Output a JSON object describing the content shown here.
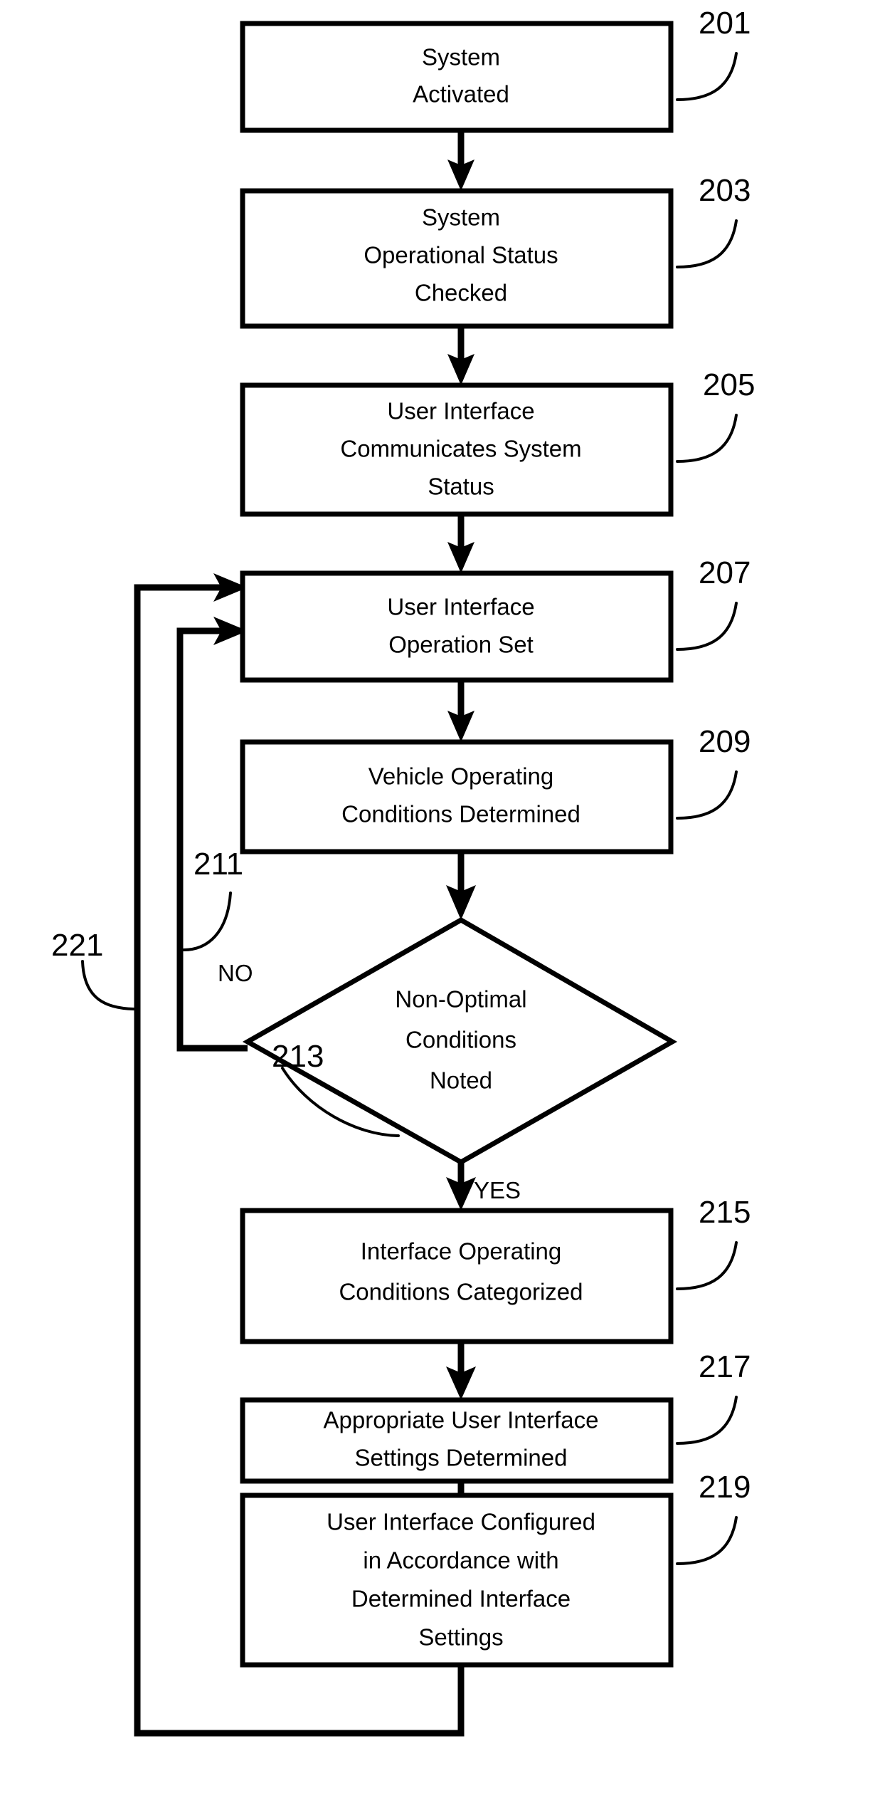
{
  "figure": {
    "type": "patent-flowchart",
    "nodes": [
      {
        "ref": "201",
        "shape": "process",
        "lines": [
          "System",
          "Activated"
        ],
        "line1": "System",
        "line2": "Activated",
        "line3": "",
        "line4": ""
      },
      {
        "ref": "203",
        "shape": "process",
        "lines": [
          "System",
          "Operational Status",
          "Checked"
        ],
        "line1": "System",
        "line2": "Operational Status",
        "line3": "Checked",
        "line4": ""
      },
      {
        "ref": "205",
        "shape": "process",
        "lines": [
          "User Interface",
          "Communicates System",
          "Status"
        ],
        "line1": "User Interface",
        "line2": "Communicates System",
        "line3": "Status",
        "line4": ""
      },
      {
        "ref": "207",
        "shape": "process",
        "lines": [
          "User Interface",
          "Operation Set"
        ],
        "line1": "User Interface",
        "line2": "Operation Set",
        "line3": "",
        "line4": ""
      },
      {
        "ref": "209",
        "shape": "process",
        "lines": [
          "Vehicle Operating",
          "Conditions Determined"
        ],
        "line1": "Vehicle Operating",
        "line2": "Conditions Determined",
        "line3": "",
        "line4": ""
      },
      {
        "ref": "211",
        "shape": "decision",
        "lines": [
          "Non-Optimal",
          "Conditions",
          "Noted"
        ],
        "line1": "Non-Optimal",
        "line2": "Conditions",
        "line3": "Noted",
        "line4": ""
      },
      {
        "ref": "215",
        "shape": "process",
        "lines": [
          "Interface Operating",
          "Conditions Categorized"
        ],
        "line1": "Interface Operating",
        "line2": "Conditions Categorized",
        "line3": "",
        "line4": ""
      },
      {
        "ref": "217",
        "shape": "process",
        "lines": [
          "Appropriate User Interface",
          "Settings Determined"
        ],
        "line1": "Appropriate User Interface",
        "line2": "Settings Determined",
        "line3": "",
        "line4": ""
      },
      {
        "ref": "219",
        "shape": "process",
        "lines": [
          "User Interface Configured",
          "in Accordance with",
          "Determined Interface",
          "Settings"
        ],
        "line1": "User Interface Configured",
        "line2": "in Accordance with",
        "line3": "Determined Interface",
        "line4": "Settings"
      }
    ],
    "ref_labels": {
      "n201": "201",
      "n203": "203",
      "n205": "205",
      "n207": "207",
      "n209": "209",
      "n211": "211",
      "n213": "213",
      "n215": "215",
      "n217": "217",
      "n219": "219",
      "n221": "221"
    },
    "branch_labels": {
      "no": "NO",
      "yes": "YES"
    },
    "colors": {
      "stroke": "#000000",
      "fill": "#ffffff",
      "background": "#ffffff"
    }
  }
}
